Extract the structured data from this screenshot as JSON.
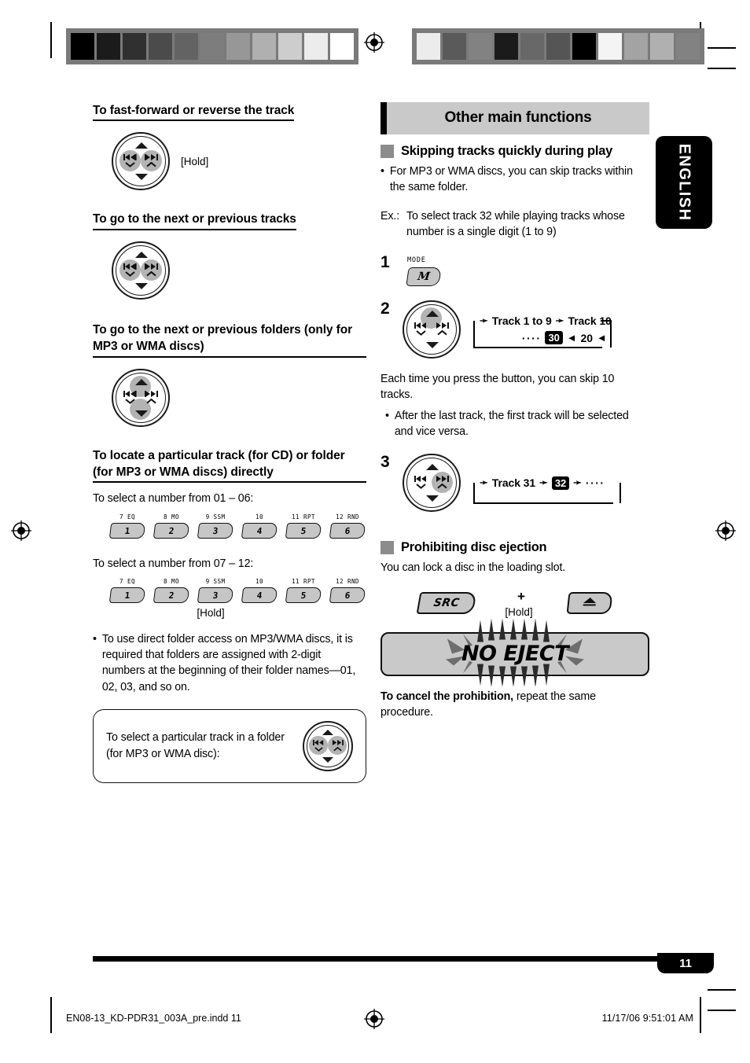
{
  "printer_marks": {
    "wedge_left": [
      "#000000",
      "#1b1b1b",
      "#303030",
      "#4b4b4b",
      "#636363",
      "#7d7d7d",
      "#979797",
      "#b0b0b0",
      "#cdcdcd",
      "#ececec",
      "#ffffff"
    ],
    "wedge_right": [
      "#ececec",
      "#5a5a5a",
      "#828282",
      "#1b1b1b",
      "#686868",
      "#555555",
      "#000000",
      "#f4f4f4",
      "#a3a3a3",
      "#b0b0b0",
      "#828282"
    ]
  },
  "language_tab": {
    "label": "ENGLISH"
  },
  "left_column": {
    "section_fast_forward": {
      "heading": "To fast-forward or reverse the track",
      "hold_label": "[Hold]"
    },
    "section_next_tracks": {
      "heading": "To go to the next or previous tracks"
    },
    "section_next_folders": {
      "heading": "To go to the next or previous folders (only for MP3 or WMA discs)"
    },
    "section_locate": {
      "heading": "To locate a particular track (for CD) or folder (for MP3 or WMA discs) directly",
      "label_01_06": "To select a number from 01 – 06:",
      "label_07_12": "To select a number from 07 – 12:",
      "hold_label": "[Hold]",
      "keys": [
        {
          "caption": "7 EQ",
          "digit": "1"
        },
        {
          "caption": "8 MO",
          "digit": "2"
        },
        {
          "caption": "9 SSM",
          "digit": "3"
        },
        {
          "caption": "10",
          "digit": "4"
        },
        {
          "caption": "11 RPT",
          "digit": "5"
        },
        {
          "caption": "12 RND",
          "digit": "6"
        }
      ],
      "note_bullet": "•",
      "note": "To use direct folder access on MP3/WMA discs, it is required that folders are assigned with 2-digit numbers at the beginning of their folder names—01, 02, 03, and so on."
    },
    "callout": {
      "line1": "To select a particular track in a folder",
      "line2": "(for MP3 or WMA disc):"
    }
  },
  "right_column": {
    "banner_title": "Other main functions",
    "skipping": {
      "heading": "Skipping tracks quickly during play",
      "bullet": "•",
      "bullet_text": "For MP3 or WMA discs, you can skip tracks within the same folder.",
      "ex_label": "Ex.:",
      "ex_text": "To select track 32 while playing tracks whose number is a single digit (1 to 9)",
      "step1": {
        "number": "1",
        "key_caption": "MODE",
        "key_label": "M"
      },
      "step2": {
        "number": "2",
        "flow_top": [
          "Track 1 to 9",
          "Track 10"
        ],
        "flow_bottom_dots": "····",
        "flow_bottom_chip": "30",
        "flow_bottom_value": "20",
        "after_text": "Each time you press the button, you can skip 10 tracks.",
        "after_bullet": "•",
        "after_bullet_text": "After the last track, the first track will be selected and vice versa."
      },
      "step3": {
        "number": "3",
        "flow_label": "Track 31",
        "flow_chip": "32",
        "flow_dots": "····"
      }
    },
    "prohibiting": {
      "heading": "Prohibiting disc ejection",
      "intro": "You can lock a disc in the loading slot.",
      "src_key": "SRC",
      "plus": "+",
      "hold_label": "[Hold]",
      "display_text": "NO EJECT",
      "cancel_bold": "To cancel the prohibition,",
      "cancel_rest": " repeat the same procedure."
    }
  },
  "footer": {
    "page_number": "11",
    "file_name": "EN08-13_KD-PDR31_003A_pre.indd   11",
    "timestamp": "11/17/06   9:51:01 AM"
  }
}
